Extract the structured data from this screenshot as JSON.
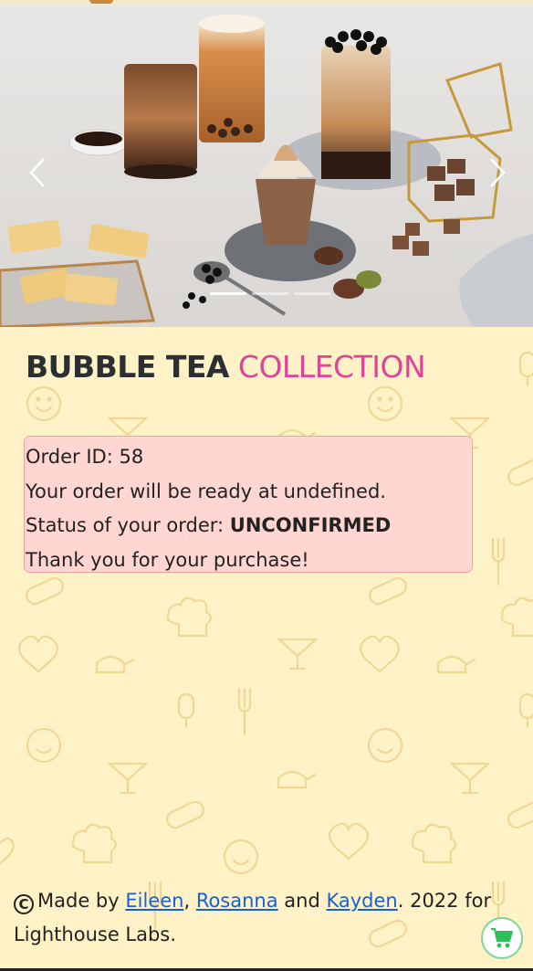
{
  "hero": {
    "image_alt": "Bubble tea drinks with desserts",
    "prev_symbol": "‹",
    "next_symbol": "›"
  },
  "title": {
    "word1": "BUBBLE TEA",
    "word2": "COLLECTION"
  },
  "order": {
    "id_line": "Order ID: 58",
    "ready_line": "Your order will be ready at undefined.",
    "status_prefix": "Status of your order: ",
    "status_value": "UNCONFIRMED",
    "thanks_line": "Thank you for your purchase!"
  },
  "footer": {
    "made_by": "Made by ",
    "author1": "Eileen",
    "sep1": ", ",
    "author2": "Rosanna",
    "sep2": " and ",
    "author3": "Kayden",
    "suffix": ". 2022 for Lighthouse Labs."
  },
  "cart": {
    "icon": "cart-icon"
  },
  "colors": {
    "background": "#fff2c6",
    "accent_pink": "#e0439a",
    "order_box_bg": "#ffd6d2",
    "link": "#1a5fd6",
    "cart_green": "#2fbf5a"
  }
}
